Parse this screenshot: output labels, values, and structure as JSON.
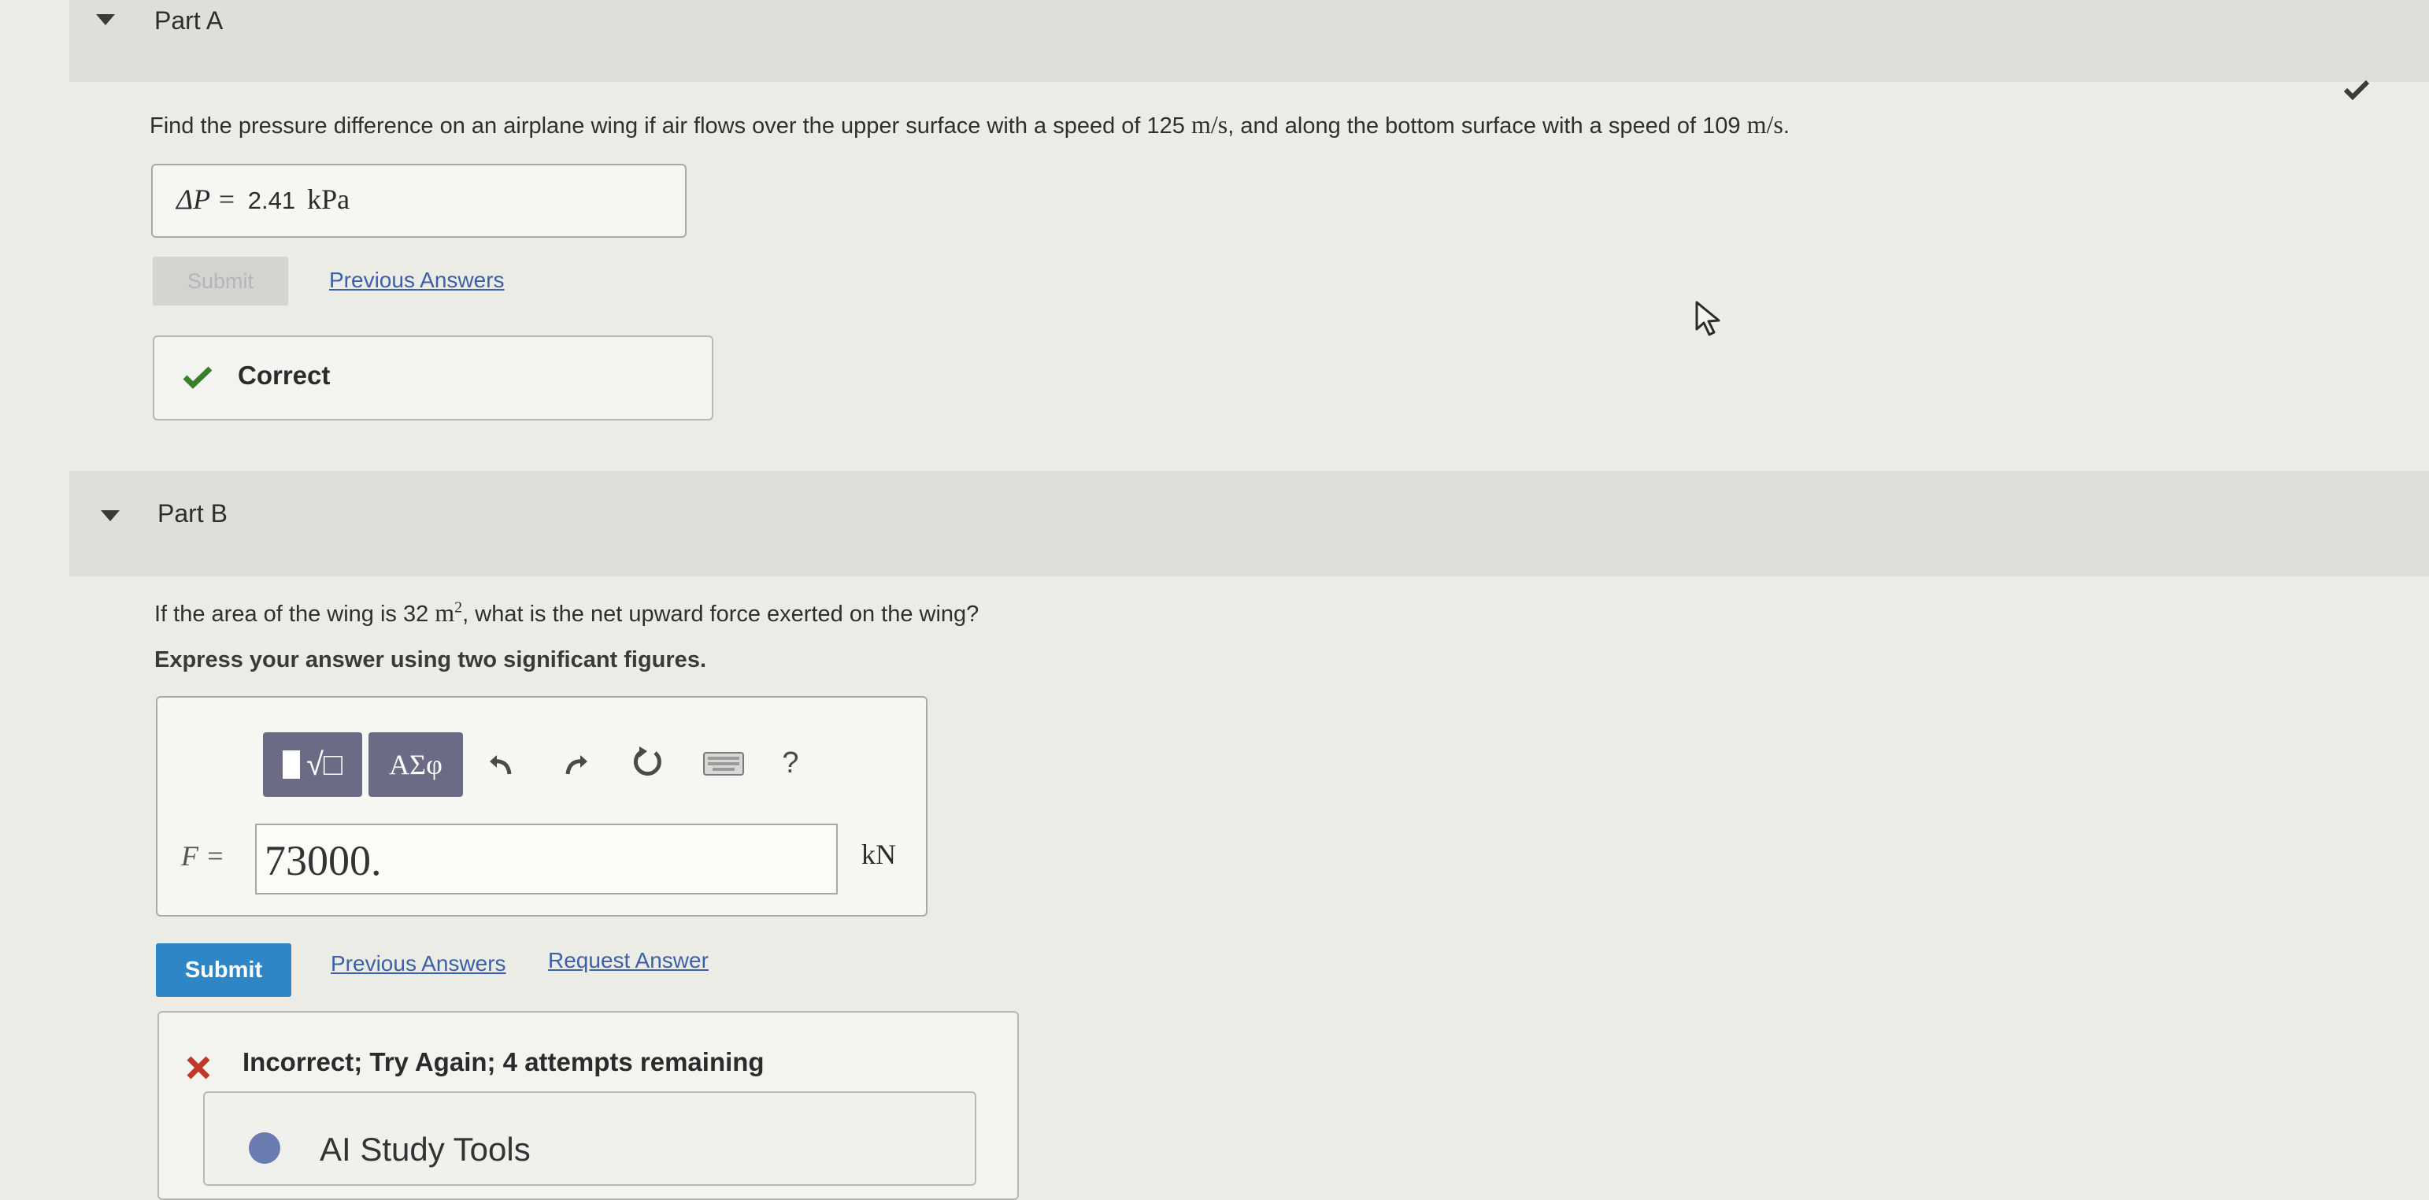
{
  "part_a": {
    "title": "Part A",
    "question_prefix": "Find the pressure difference on an airplane wing if air flows over the upper surface with a speed of 125",
    "unit_1": "m/s",
    "question_middle": ", and along the bottom surface with a speed of 109",
    "unit_2": "m/s",
    "question_end": ".",
    "answer_var": "ΔP =",
    "answer_value": "2.41",
    "answer_unit": "kPa",
    "submit_label": "Submit",
    "previous_answers_label": "Previous Answers",
    "feedback_label": "Correct"
  },
  "part_b": {
    "title": "Part B",
    "question_prefix": "If the area of the wing is 32",
    "unit": "m",
    "unit_exp": "2",
    "question_suffix": ", what is the net upward force exerted on the wing?",
    "instruction": "Express your answer using two significant figures.",
    "toolbar": {
      "templates_label": "√□",
      "symbols_label": "ΑΣφ",
      "help_label": "?"
    },
    "answer_var": "F =",
    "answer_value": "73000.",
    "answer_unit": "kN",
    "submit_label": "Submit",
    "previous_answers_label": "Previous Answers",
    "request_answer_label": "Request Answer",
    "feedback_label": "Incorrect; Try Again; 4 attempts remaining",
    "ai_tools_label": "AI Study Tools"
  },
  "colors": {
    "primary": "#2f86c6",
    "correct": "#3a7d2c",
    "incorrect": "#c0392b"
  }
}
